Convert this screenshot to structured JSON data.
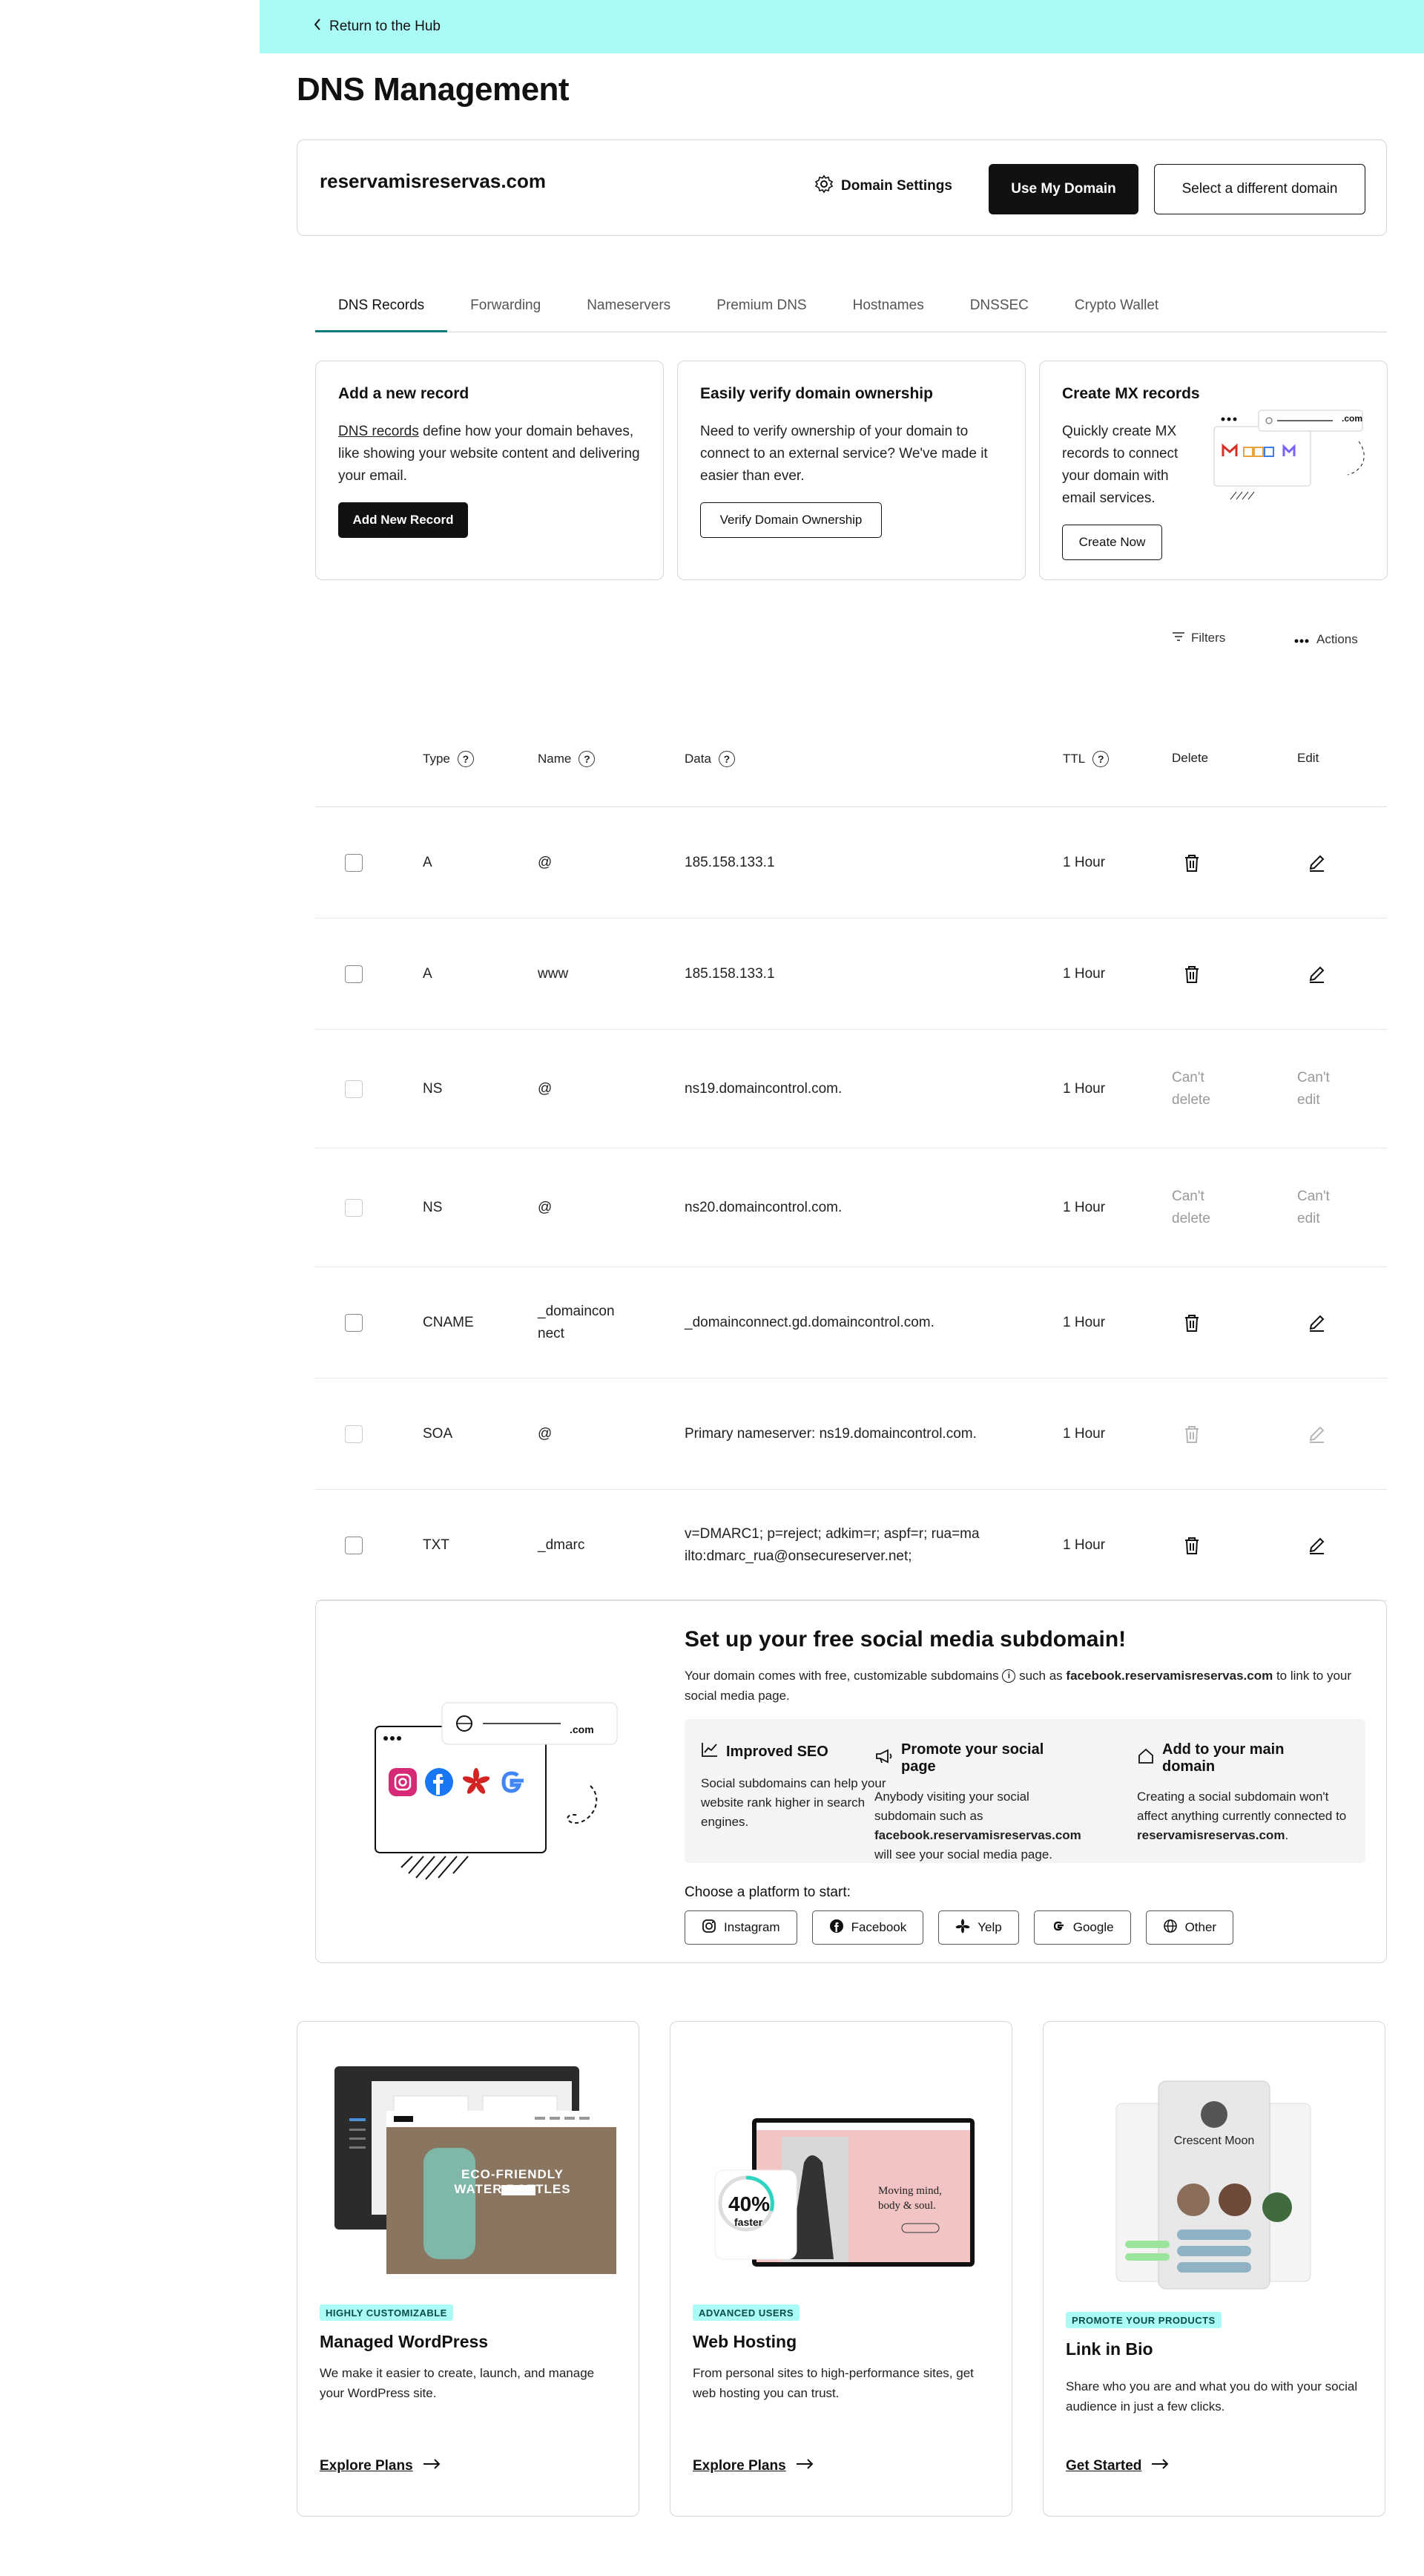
{
  "topbar": {
    "back_label": "Return to the Hub"
  },
  "page_title": "DNS Management",
  "domain_card": {
    "domain": "reservamisreservas.com",
    "settings_label": "Domain Settings",
    "use_domain_label": "Use My Domain",
    "select_domain_label": "Select a different domain"
  },
  "tabs": [
    "DNS Records",
    "Forwarding",
    "Nameservers",
    "Premium DNS",
    "Hostnames",
    "DNSSEC",
    "Crypto Wallet"
  ],
  "cards": {
    "add_record": {
      "title": "Add a new record",
      "link": "DNS records",
      "desc": " define how your domain behaves, like showing your website content and delivering your email.",
      "button": "Add New Record"
    },
    "verify": {
      "title": "Easily verify domain ownership",
      "desc": "Need to verify ownership of your domain to connect to an external service? We've made it easier than ever.",
      "button": "Verify Domain Ownership"
    },
    "mx": {
      "title": "Create MX records",
      "desc": "Quickly create MX records to connect your domain with email services.",
      "button": "Create Now",
      "illustration_text": ".com"
    }
  },
  "toolbar": {
    "filters": "Filters",
    "actions": "Actions"
  },
  "table": {
    "headers": {
      "type": "Type",
      "name": "Name",
      "data": "Data",
      "ttl": "TTL",
      "delete": "Delete",
      "edit": "Edit"
    },
    "cant_delete": "Can't delete",
    "cant_edit": "Can't edit",
    "rows": [
      {
        "type": "A",
        "name": "@",
        "data": "185.158.133.1",
        "ttl": "1 Hour",
        "mode": "editable"
      },
      {
        "type": "A",
        "name": "www",
        "data": "185.158.133.1",
        "ttl": "1 Hour",
        "mode": "editable"
      },
      {
        "type": "NS",
        "name": "@",
        "data": "ns19.domaincontrol.com.",
        "ttl": "1 Hour",
        "mode": "locked"
      },
      {
        "type": "NS",
        "name": "@",
        "data": "ns20.domaincontrol.com.",
        "ttl": "1 Hour",
        "mode": "locked"
      },
      {
        "type": "CNAME",
        "name": "_domaincon nect",
        "data": "_domainconnect.gd.domaincontrol.com.",
        "ttl": "1 Hour",
        "mode": "editable"
      },
      {
        "type": "SOA",
        "name": "@",
        "data": "Primary nameserver: ns19.domaincontrol.com.",
        "ttl": "1 Hour",
        "mode": "disabled"
      },
      {
        "type": "TXT",
        "name": "_dmarc",
        "data": "v=DMARC1; p=reject; adkim=r; aspf=r; rua=ma ilto:dmarc_rua@onsecureserver.net;",
        "ttl": "1 Hour",
        "mode": "editable"
      }
    ]
  },
  "social": {
    "title": "Set up your free social media subdomain!",
    "desc_1": "Your domain comes with free, customizable subdomains",
    "desc_2": " such as ",
    "desc_example": "facebook.reservamisreservas.com",
    "desc_3": " to link to your social media page.",
    "illustration_text": ".com",
    "benefits": [
      {
        "title": "Improved SEO",
        "desc": "Social subdomains can help your website rank higher in search engines."
      },
      {
        "title": "Promote your social page",
        "desc_1": "Anybody visiting your social subdomain such as ",
        "desc_bold": "facebook.reservamisreservas.com",
        "desc_2": " will see your social media page."
      },
      {
        "title": "Add to your main domain",
        "desc_1": "Creating a social subdomain won't affect anything currently connected to ",
        "desc_bold": "reservamisreservas.com",
        "desc_2": "."
      }
    ],
    "platform_label": "Choose a platform to start:",
    "platforms": [
      "Instagram",
      "Facebook",
      "Yelp",
      "Google",
      "Other"
    ]
  },
  "promos": [
    {
      "badge": "HIGHLY CUSTOMIZABLE",
      "title": "Managed WordPress",
      "desc": "We make it easier to create, launch, and manage your WordPress site.",
      "link": "Explore Plans",
      "img_text": "ECO-FRIENDLY WATER BOTTLES"
    },
    {
      "badge": "ADVANCED USERS",
      "title": "Web Hosting",
      "desc": "From personal sites to high-performance sites, get web hosting you can trust.",
      "link": "Explore Plans",
      "img_percent": "40%",
      "img_faster": "faster",
      "img_headline": "Moving mind, body & soul."
    },
    {
      "badge": "PROMOTE YOUR PRODUCTS",
      "title": "Link in Bio",
      "desc": "Share who you are and what you do with your social audience in just a few clicks.",
      "link": "Get Started",
      "img_name": "Crescent Moon"
    }
  ]
}
